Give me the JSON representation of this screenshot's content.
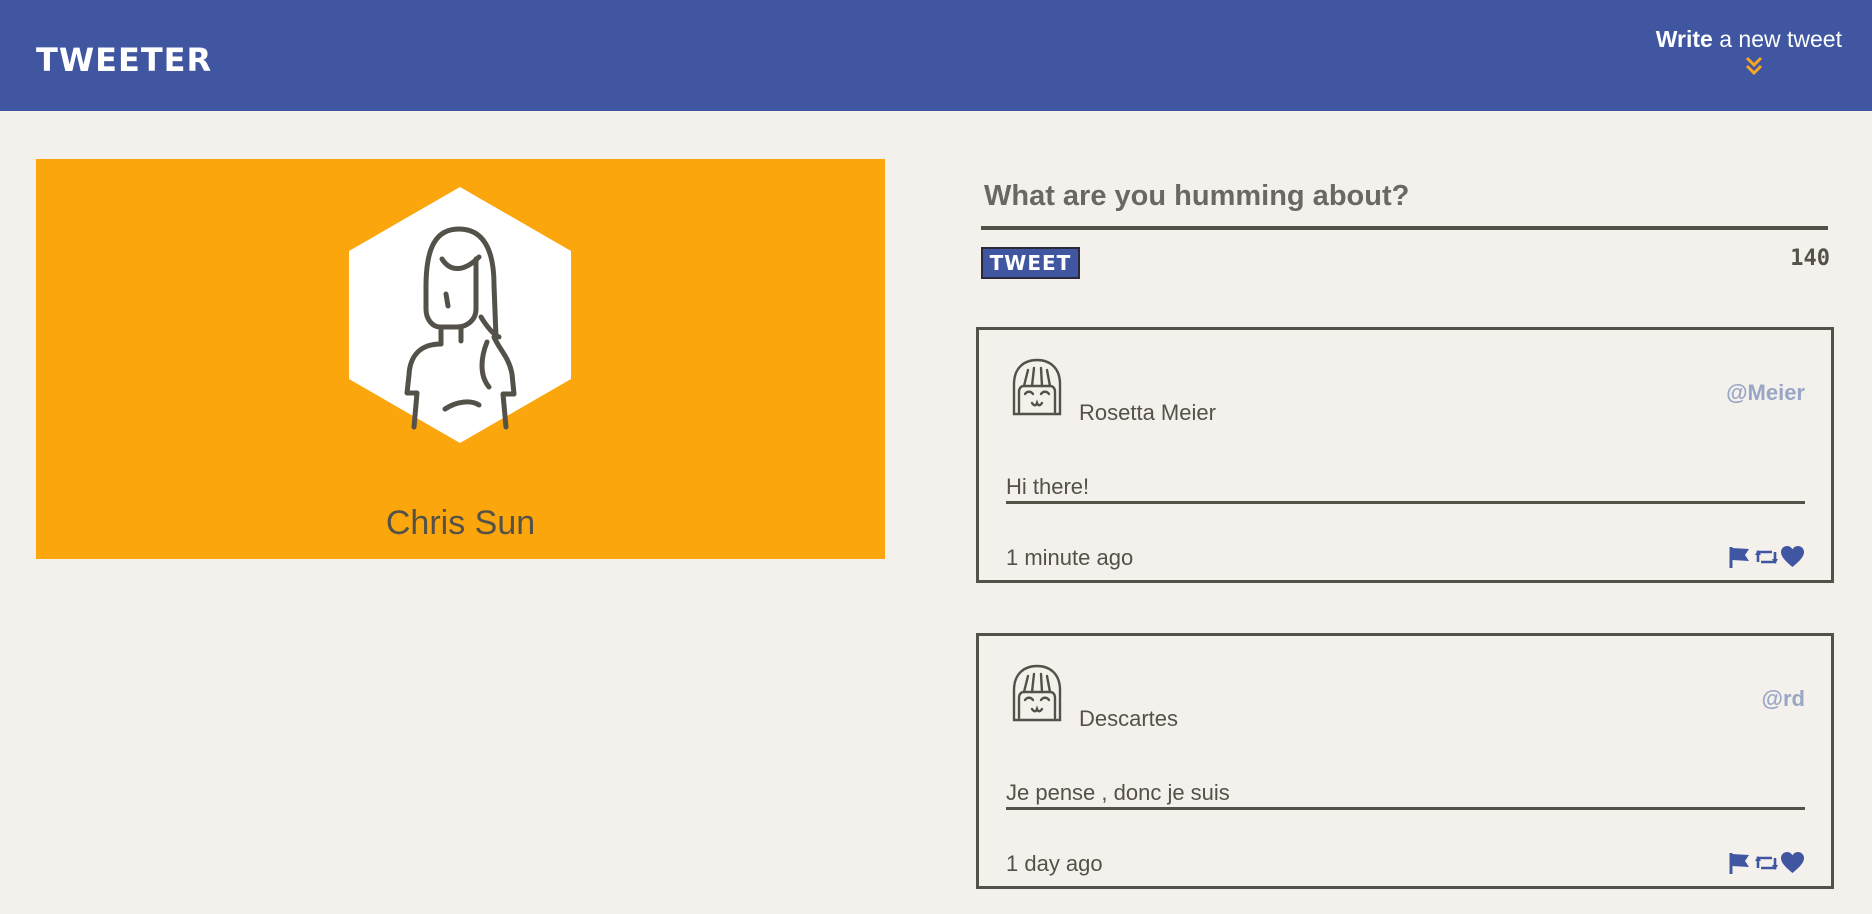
{
  "header": {
    "brand": "TWEETER",
    "compose_link_bold": "Write",
    "compose_link_rest": " a new tweet"
  },
  "profile": {
    "name": "Chris Sun"
  },
  "compose": {
    "placeholder": "What are you humming about?",
    "button_label": "TWEET",
    "counter": "140"
  },
  "tweets": [
    {
      "author": "Rosetta Meier",
      "handle": "@Meier",
      "content": "Hi there!",
      "time": "1 minute ago"
    },
    {
      "author": "Descartes",
      "handle": "@rd",
      "content": "Je pense , donc je suis",
      "time": "1 day ago"
    }
  ],
  "colors": {
    "navbar": "#4056a1",
    "profile_banner": "#fca60d",
    "page_background": "#f4f1ec",
    "text": "#545149",
    "handle": "#9aa6c6",
    "accent_arrows": "#f5a623"
  },
  "icons": {
    "compose_toggle": "double-chevron-down-icon",
    "profile_avatar": "person-avatar-icon",
    "tweet_avatar": "face-avatar-icon",
    "flag": "flag-icon",
    "retweet": "retweet-icon",
    "like": "heart-icon"
  }
}
